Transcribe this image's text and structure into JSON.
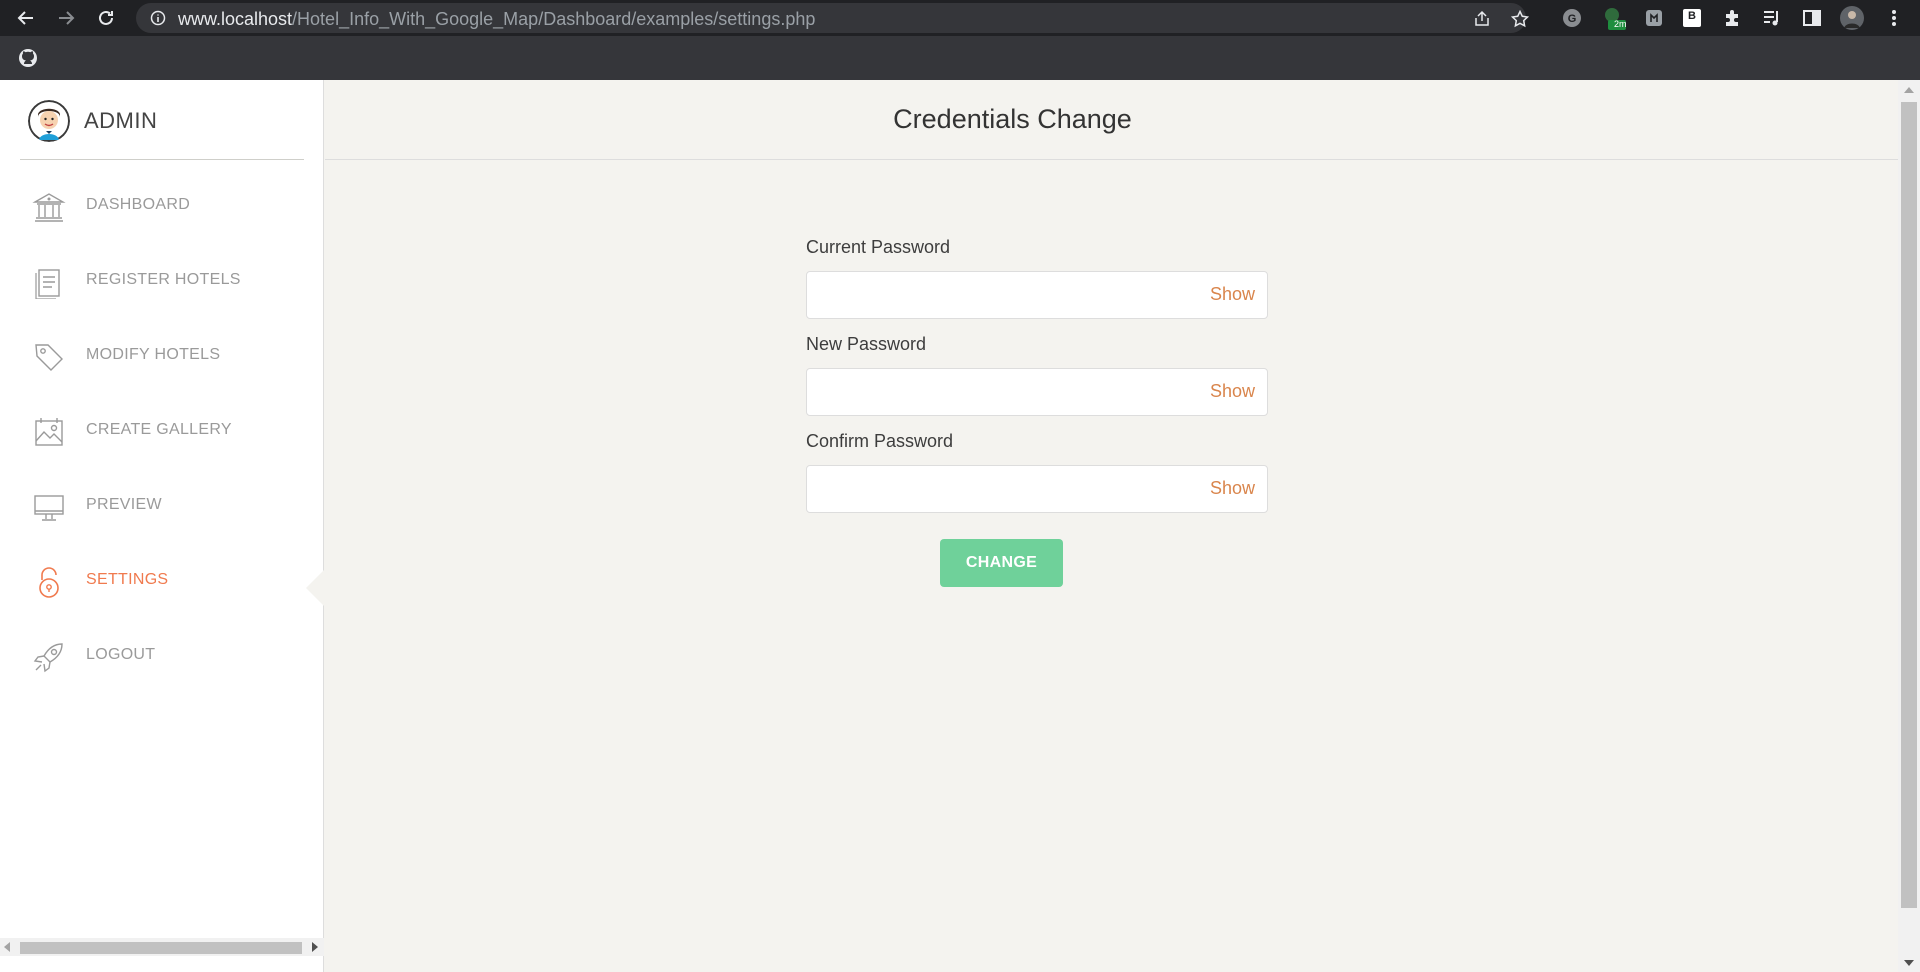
{
  "browser": {
    "url_host": "www.localhost",
    "url_path": "/Hotel_Info_With_Google_Map/Dashboard/examples/settings.php",
    "extension_badge": "2m",
    "extension_b_letter": "B"
  },
  "sidebar": {
    "brand": "ADMIN",
    "items": [
      {
        "label": "DASHBOARD",
        "icon": "bank-icon"
      },
      {
        "label": "REGISTER HOTELS",
        "icon": "document-icon"
      },
      {
        "label": "MODIFY HOTELS",
        "icon": "tag-icon"
      },
      {
        "label": "CREATE GALLERY",
        "icon": "image-icon"
      },
      {
        "label": "PREVIEW",
        "icon": "monitor-icon"
      },
      {
        "label": "SETTINGS",
        "icon": "lock-icon"
      },
      {
        "label": "LOGOUT",
        "icon": "rocket-icon"
      }
    ],
    "active_index": 5
  },
  "main": {
    "title": "Credentials Change",
    "fields": [
      {
        "label": "Current Password",
        "value": "",
        "toggle": "Show"
      },
      {
        "label": "New Password",
        "value": "",
        "toggle": "Show"
      },
      {
        "label": "Confirm Password",
        "value": "",
        "toggle": "Show"
      }
    ],
    "submit_label": "CHANGE"
  },
  "colors": {
    "accent": "#f07a4e",
    "show_link": "#d9854c",
    "button": "#6fd19a",
    "background": "#f4f3ef"
  }
}
